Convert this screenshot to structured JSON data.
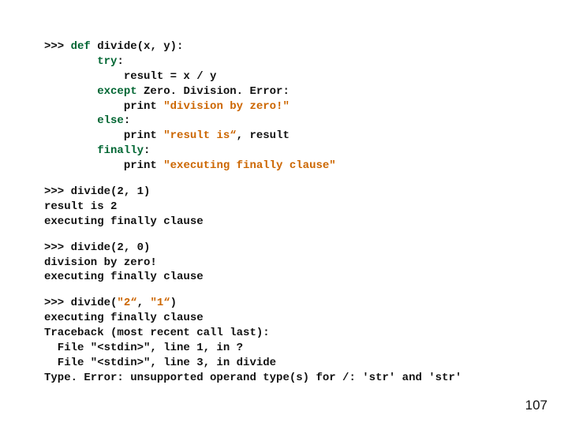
{
  "def": {
    "l1_prompt": ">>> ",
    "l1_def": "def",
    "l1_rest": " divide(x, y):",
    "l2_indent": "        ",
    "l2_try": "try",
    "l2_colon": ":",
    "l3": "            result = x / y",
    "l4_indent": "        ",
    "l4_except": "except ",
    "l4_rest": "Zero. Division. Error:",
    "l5_indent": "            print ",
    "l5_str": "\"division by zero!\"",
    "l6_indent": "        ",
    "l6_else": "else",
    "l6_colon": ":",
    "l7_indent": "            print ",
    "l7_str": "\"result is“",
    "l7_rest": ", result",
    "l8_indent": "        ",
    "l8_finally": "finally",
    "l8_colon": ":",
    "l9_indent": "            print ",
    "l9_str": "\"executing finally clause\""
  },
  "run1": {
    "l1": ">>> divide(2, 1)",
    "l2": "result is 2",
    "l3": "executing finally clause"
  },
  "run2": {
    "l1": ">>> divide(2, 0)",
    "l2": "division by zero!",
    "l3": "executing finally clause"
  },
  "run3": {
    "l1_a": ">>> divide(",
    "l1_s1": "\"2“",
    "l1_b": ", ",
    "l1_s2": "\"1“",
    "l1_c": ")",
    "l2": "executing finally clause",
    "l3": "Traceback (most recent call last):",
    "l4": "  File \"<stdin>\", line 1, in ?",
    "l5": "  File \"<stdin>\", line 3, in divide",
    "l6": "Type. Error: unsupported operand type(s) for /: 'str' and 'str'"
  },
  "page_number": "107"
}
